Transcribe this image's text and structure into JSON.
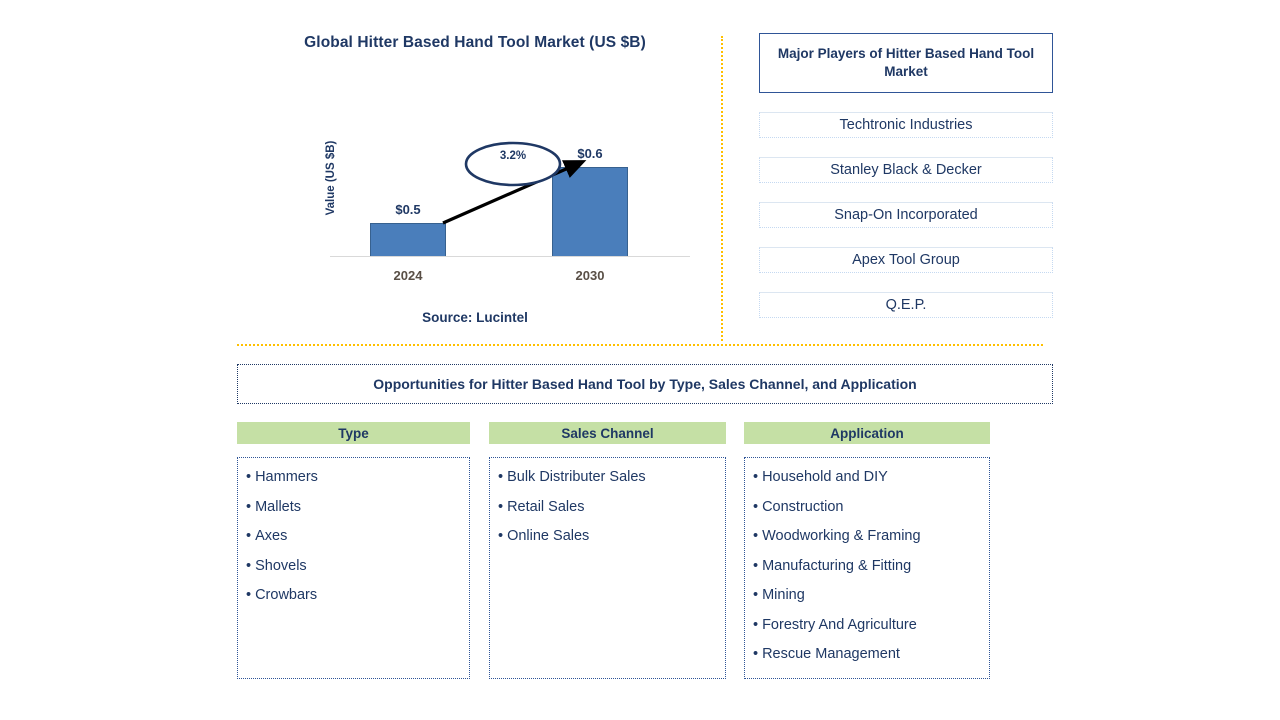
{
  "chart_panel": {
    "title": "Global Hitter Based Hand Tool Market (US $B)",
    "source": "Source: Lucintel"
  },
  "chart_data": {
    "type": "bar",
    "title": "Global Hitter Based Hand Tool Market (US $B)",
    "categories": [
      "2024",
      "2030"
    ],
    "values": [
      0.5,
      0.6
    ],
    "data_labels": [
      "$0.5",
      "$0.6"
    ],
    "xlabel": "",
    "ylabel": "Value (US $B)",
    "ylim": [
      0,
      0.7
    ],
    "grid": false,
    "legend": "none",
    "bar_color": "#4a7ebb",
    "annotation": {
      "label": "3.2%",
      "shape": "ellipse-with-arrow",
      "meaning": "CAGR from 2024 to 2030"
    }
  },
  "players": {
    "header": "Major Players of Hitter Based Hand Tool Market",
    "items": [
      "Techtronic Industries",
      "Stanley Black & Decker",
      "Snap-On Incorporated",
      "Apex Tool Group",
      "Q.E.P."
    ]
  },
  "opportunities": {
    "title": "Opportunities for Hitter Based Hand Tool by Type, Sales Channel, and Application",
    "columns": [
      {
        "header": "Type",
        "items": [
          "Hammers",
          "Mallets",
          "Axes",
          "Shovels",
          "Crowbars"
        ]
      },
      {
        "header": "Sales Channel",
        "items": [
          "Bulk Distributer Sales",
          "Retail Sales",
          "Online Sales"
        ]
      },
      {
        "header": "Application",
        "items": [
          "Household and DIY",
          "Construction",
          "Woodworking & Framing",
          "Manufacturing & Fitting",
          "Mining",
          "Forestry And Agriculture",
          "Rescue Management"
        ]
      }
    ]
  },
  "bullet_glyph": "•",
  "colors": {
    "navy": "#1f3864",
    "bar_blue": "#4a7ebb",
    "green_header": "#c5e0a5",
    "divider_orange": "#ffc000",
    "tick_gray": "#594f46"
  }
}
